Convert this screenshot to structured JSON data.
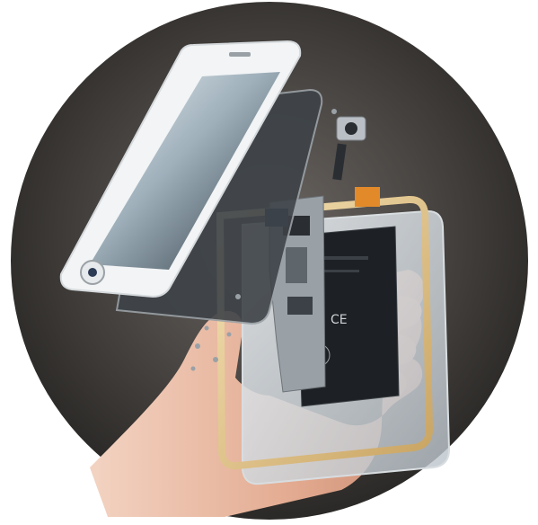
{
  "scene": {
    "description_tag": "exploded-smartphone-in-hand",
    "colors": {
      "background": "#ffffff",
      "circle_outer": "#2f2d2c",
      "circle_inner": "#5b5754",
      "gold_frame": "#e6c98a",
      "skin": "#e9b9a1",
      "board": "#9aa1a6",
      "battery": "#1d2024",
      "glass": "#cfd6db",
      "accent_orange": "#e28a2a"
    },
    "battery_text": "CE"
  }
}
